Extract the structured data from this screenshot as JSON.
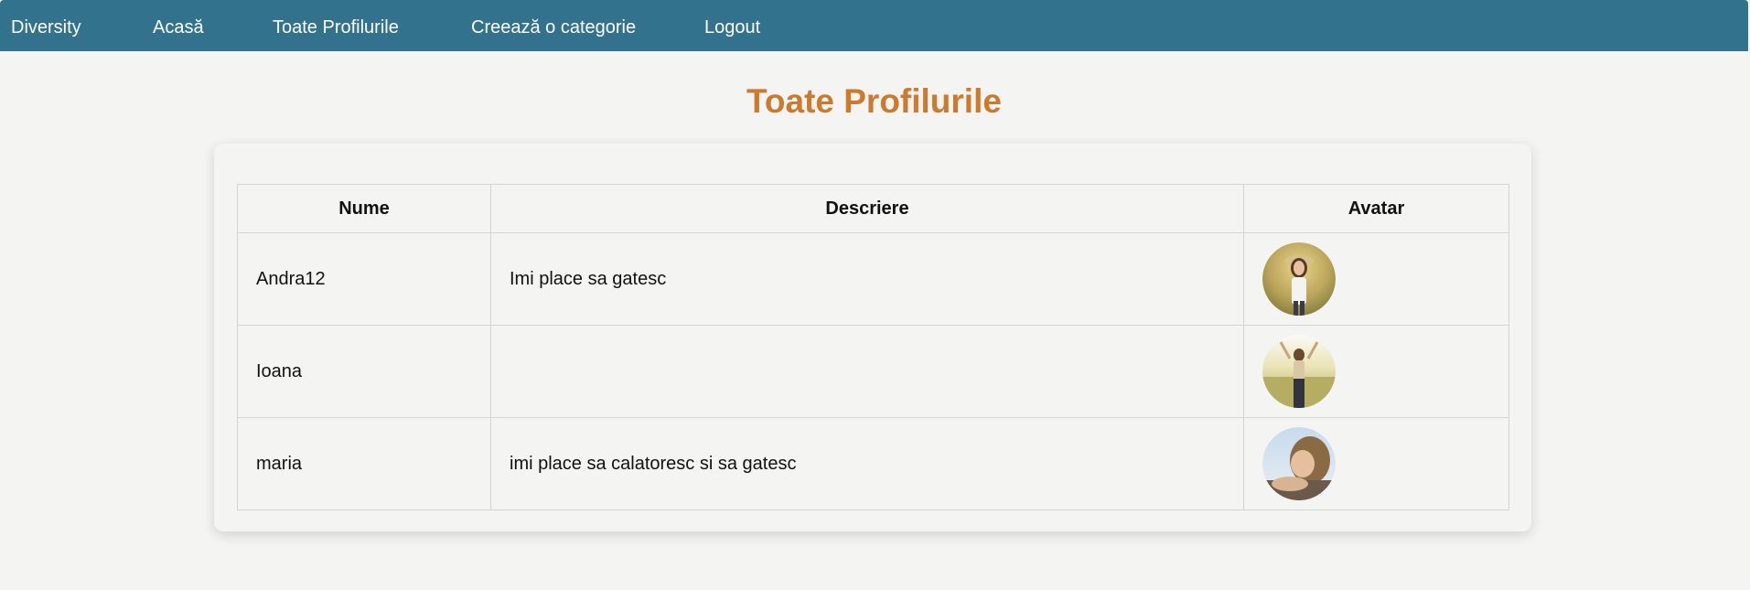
{
  "nav": {
    "brand": "Diversity",
    "home": "Acasă",
    "profiles": "Toate Profilurile",
    "create_category": "Creează o categorie",
    "logout": "Logout"
  },
  "page": {
    "title": "Toate Profilurile"
  },
  "table": {
    "headers": [
      "Nume",
      "Descriere",
      "Avatar"
    ],
    "rows": [
      {
        "name": "Andra12",
        "description": "Imi place sa gatesc"
      },
      {
        "name": "Ioana",
        "description": ""
      },
      {
        "name": "maria",
        "description": "imi place sa calatoresc si sa gatesc"
      }
    ]
  },
  "colors": {
    "navbar": "#33728c",
    "title": "#cc7a2e",
    "background": "#f4f4f2"
  }
}
